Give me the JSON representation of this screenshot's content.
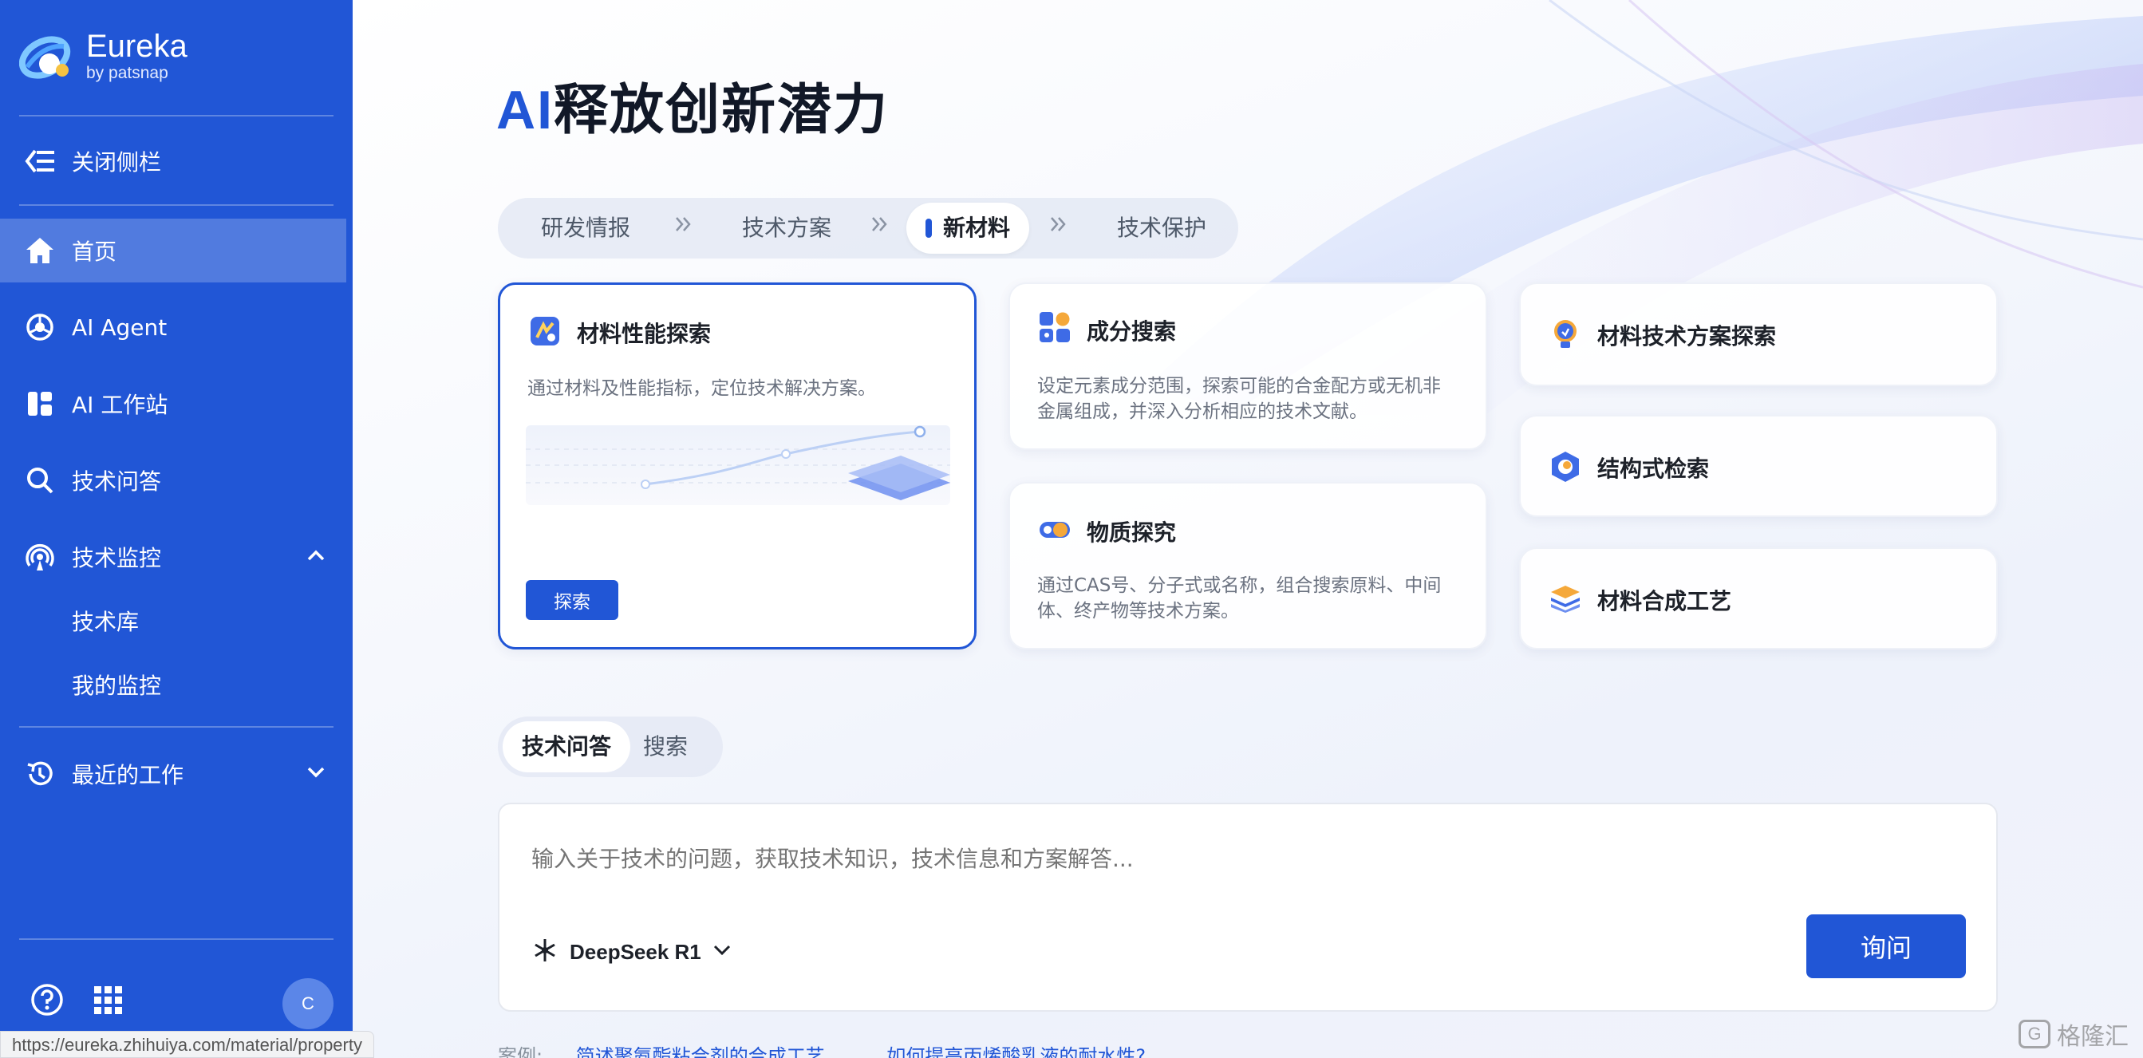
{
  "brand": {
    "name": "Eureka",
    "sub": "by patsnap"
  },
  "sidebar": {
    "collapse_label": "关闭侧栏",
    "items": [
      {
        "label": "首页",
        "icon": "home-icon"
      },
      {
        "label": "AI Agent",
        "icon": "agent-icon"
      },
      {
        "label": "AI 工作站",
        "icon": "workstation-icon"
      },
      {
        "label": "技术问答",
        "icon": "search-icon"
      },
      {
        "label": "技术监控",
        "icon": "monitor-icon"
      },
      {
        "label": "最近的工作",
        "icon": "history-icon"
      }
    ],
    "monitor_sub": [
      "技术库",
      "我的监控"
    ],
    "avatar": "C"
  },
  "hero": {
    "ai": "AI",
    "title": "释放创新潜力"
  },
  "tabs": [
    "研发情报",
    "技术方案",
    "新材料",
    "技术保护"
  ],
  "cards": {
    "material_property": {
      "title": "材料性能探索",
      "desc": "通过材料及性能指标，定位技术解决方案。",
      "button": "探索"
    },
    "composition": {
      "title": "成分搜索",
      "desc_line1": "设定元素成分范围，探索可能的合金配方或无机非",
      "desc_line2": "金属组成，并深入分析相应的技术文献。"
    },
    "substance": {
      "title": "物质探究",
      "desc_line1": "通过CAS号、分子式或名称，组合搜索原料、中间",
      "desc_line2": "体、终产物等技术方案。"
    },
    "solution": {
      "title": "材料技术方案探索"
    },
    "structure": {
      "title": "结构式检索"
    },
    "synthesis": {
      "title": "材料合成工艺"
    }
  },
  "chat": {
    "tabs": [
      "技术问答",
      "搜索"
    ],
    "placeholder": "输入关于技术的问题，获取技术知识，技术信息和方案解答...",
    "model": "DeepSeek R1",
    "ask": "询问"
  },
  "examples": {
    "label": "案例:",
    "items": [
      "简述聚氨酯粘合剂的合成工艺",
      "如何提高丙烯酸乳液的耐水性?"
    ]
  },
  "status_url": "https://eureka.zhihuiya.com/material/property",
  "watermark": "格隆汇",
  "colors": {
    "primary": "#2156d6",
    "sidebar": "#2156d6"
  }
}
